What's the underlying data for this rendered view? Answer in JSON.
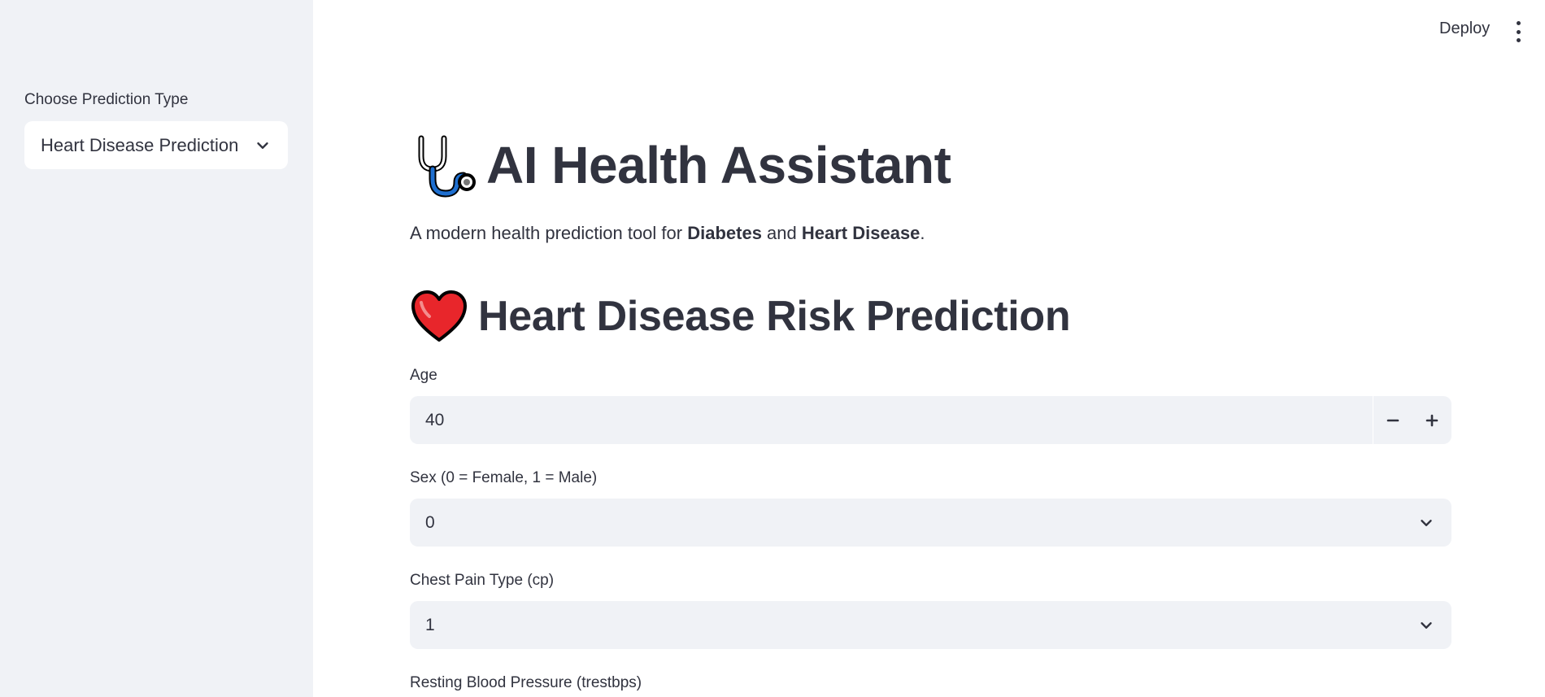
{
  "sidebar": {
    "select_label": "Choose Prediction Type",
    "select_value": "Heart Disease Prediction"
  },
  "topbar": {
    "deploy_label": "Deploy"
  },
  "main": {
    "title": "AI Health Assistant",
    "intro_prefix": "A modern health prediction tool for ",
    "intro_bold1": "Diabetes",
    "intro_mid": " and ",
    "intro_bold2": "Heart Disease",
    "intro_suffix": ".",
    "section_title": "Heart Disease Risk Prediction",
    "fields": {
      "age": {
        "label": "Age",
        "value": "40"
      },
      "sex": {
        "label": "Sex (0 = Female, 1 = Male)",
        "value": "0"
      },
      "cp": {
        "label": "Chest Pain Type (cp)",
        "value": "1"
      },
      "trestbps": {
        "label": "Resting Blood Pressure (trestbps)"
      }
    }
  },
  "icons": {
    "title_icon": "stethoscope-icon",
    "section_icon": "heart-icon"
  }
}
